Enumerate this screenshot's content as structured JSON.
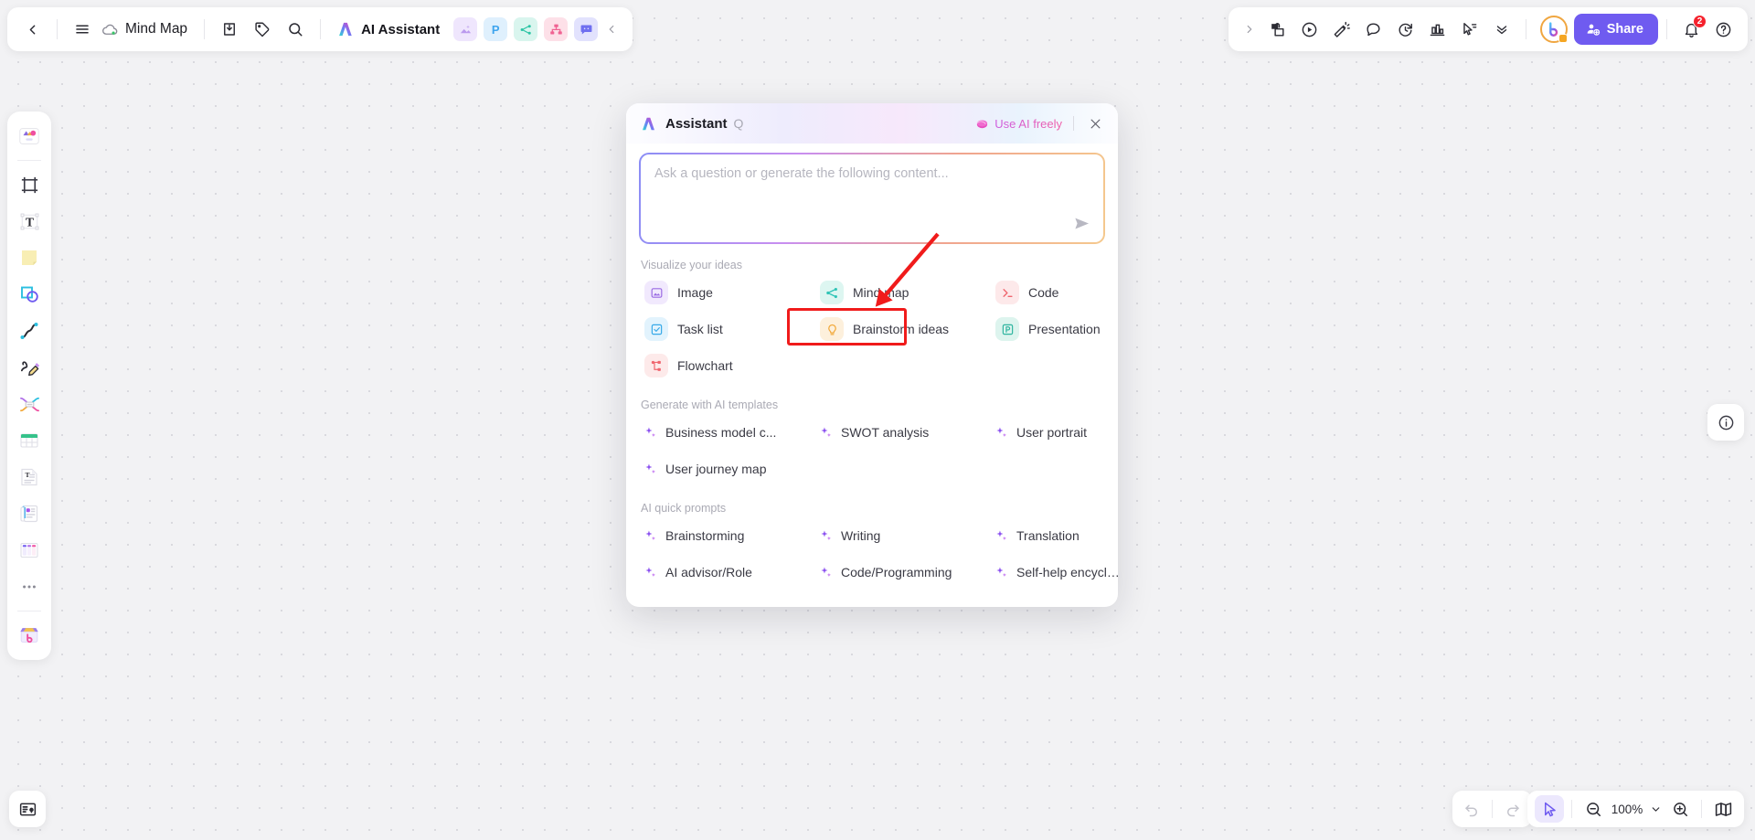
{
  "topbar": {
    "back_icon": "chevron-left-icon",
    "menu_icon": "hamburger-menu-icon",
    "cloud_icon": "cloud-saved-icon",
    "doc_title": "Mind Map",
    "export_icon": "download-icon",
    "tag_icon": "tag-icon",
    "search_icon": "search-icon",
    "ai_assistant_label": "AI Assistant",
    "app_chips": [
      {
        "name": "image-app-icon",
        "label": "Image",
        "bg": "#efe6fd",
        "fg": "#a97ce8"
      },
      {
        "name": "presentation-app-icon",
        "label": "P",
        "bg": "#dff0fd",
        "fg": "#3fa5ee"
      },
      {
        "name": "mindmap-app-icon",
        "label": "Mind map",
        "bg": "#d9f5ee",
        "fg": "#2bc4a4"
      },
      {
        "name": "flowchart-app-icon",
        "label": "Flowchart",
        "bg": "#fde0e8",
        "fg": "#f06292"
      },
      {
        "name": "comment-app-icon",
        "label": "Comment",
        "bg": "#e2e2fd",
        "fg": "#6f6ff0"
      }
    ],
    "collapse_icon": "chevron-left-icon"
  },
  "topbar_right": {
    "expand_icon": "chevron-right-icon",
    "tools": [
      {
        "name": "lock-page-icon"
      },
      {
        "name": "play-circle-icon"
      },
      {
        "name": "announce-icon"
      },
      {
        "name": "comment-bubble-icon"
      },
      {
        "name": "timer-icon"
      },
      {
        "name": "vote-chart-icon"
      },
      {
        "name": "cursor-list-icon"
      },
      {
        "name": "chevrons-down-icon"
      }
    ],
    "avatar_letter": "b",
    "share_label": "Share",
    "share_color": "#6f5bf0",
    "notification_count": "2",
    "help_icon": "question-circle-icon"
  },
  "sidebar": {
    "items": [
      {
        "name": "sidebar-item-templates",
        "label": "Templates"
      },
      {
        "name": "sidebar-item-frame",
        "label": "Frame"
      },
      {
        "name": "sidebar-item-text",
        "label": "Text"
      },
      {
        "name": "sidebar-item-sticky-note",
        "label": "Sticky note"
      },
      {
        "name": "sidebar-item-shapes",
        "label": "Shapes"
      },
      {
        "name": "sidebar-item-connector",
        "label": "Connector"
      },
      {
        "name": "sidebar-item-pen",
        "label": "Pen"
      },
      {
        "name": "sidebar-item-mindmap",
        "label": "Mind map"
      },
      {
        "name": "sidebar-item-table",
        "label": "Table"
      },
      {
        "name": "sidebar-item-document",
        "label": "Document"
      },
      {
        "name": "sidebar-item-cards",
        "label": "Cards"
      },
      {
        "name": "sidebar-item-kanban",
        "label": "Kanban"
      },
      {
        "name": "sidebar-item-more",
        "label": "More"
      },
      {
        "name": "sidebar-item-app-store",
        "label": "App store"
      }
    ]
  },
  "dialog": {
    "logo_icon": "ai-logo-icon",
    "title": "Assistant",
    "title_badge": "Q",
    "use_ai_freely": "Use AI freely",
    "gift_icon": "gift-icon",
    "close_icon": "close-icon",
    "input_placeholder": "Ask a question or generate the following content...",
    "input_value": "",
    "send_icon": "send-icon",
    "sections": [
      {
        "title": "Visualize your ideas",
        "items": [
          {
            "label": "Image",
            "icon": "image-icon",
            "bg": "#f1e9fd",
            "fg": "#9a6ae3"
          },
          {
            "label": "Mind map",
            "icon": "mindmap-icon",
            "bg": "#ddf6f1",
            "fg": "#2ec4b6",
            "highlighted": true
          },
          {
            "label": "Code",
            "icon": "code-icon",
            "bg": "#fde9ea",
            "fg": "#f0666f"
          },
          {
            "label": "Task list",
            "icon": "task-list-icon",
            "bg": "#e2f3fd",
            "fg": "#37a9e8"
          },
          {
            "label": "Brainstorm ideas",
            "icon": "lightbulb-icon",
            "bg": "#fdf0dc",
            "fg": "#f2a93b"
          },
          {
            "label": "Presentation",
            "icon": "presentation-icon",
            "bg": "#ddf4ee",
            "fg": "#2fb5a0"
          },
          {
            "label": "Flowchart",
            "icon": "flowchart-icon",
            "bg": "#fdeaea",
            "fg": "#f0666f"
          }
        ]
      },
      {
        "title": "Generate with AI templates",
        "items": [
          {
            "label": "Business model c...",
            "icon": "sparkle-icon"
          },
          {
            "label": "SWOT analysis",
            "icon": "sparkle-icon"
          },
          {
            "label": "User portrait",
            "icon": "sparkle-icon"
          },
          {
            "label": "User journey map",
            "icon": "sparkle-icon"
          }
        ]
      },
      {
        "title": "AI quick prompts",
        "items": [
          {
            "label": "Brainstorming",
            "icon": "sparkle-icon"
          },
          {
            "label": "Writing",
            "icon": "sparkle-icon"
          },
          {
            "label": "Translation",
            "icon": "sparkle-icon"
          },
          {
            "label": "AI advisor/Role",
            "icon": "sparkle-icon"
          },
          {
            "label": "Code/Programming",
            "icon": "sparkle-icon"
          },
          {
            "label": "Self-help encyclo...",
            "icon": "sparkle-icon"
          }
        ]
      }
    ]
  },
  "bottombar": {
    "slides_icon": "slides-icon",
    "info_icon": "info-icon",
    "undo_icon": "undo-icon",
    "redo_icon": "redo-icon",
    "cursor_icon": "cursor-arrow-icon",
    "zoom_out_icon": "zoom-out-icon",
    "zoom_level": "100%",
    "zoom_dropdown_icon": "chevron-down-icon",
    "zoom_in_icon": "zoom-in-icon",
    "minimap_icon": "minimap-icon"
  },
  "annotation": {
    "highlight_color": "#f01b1b",
    "target": "Mind map"
  }
}
